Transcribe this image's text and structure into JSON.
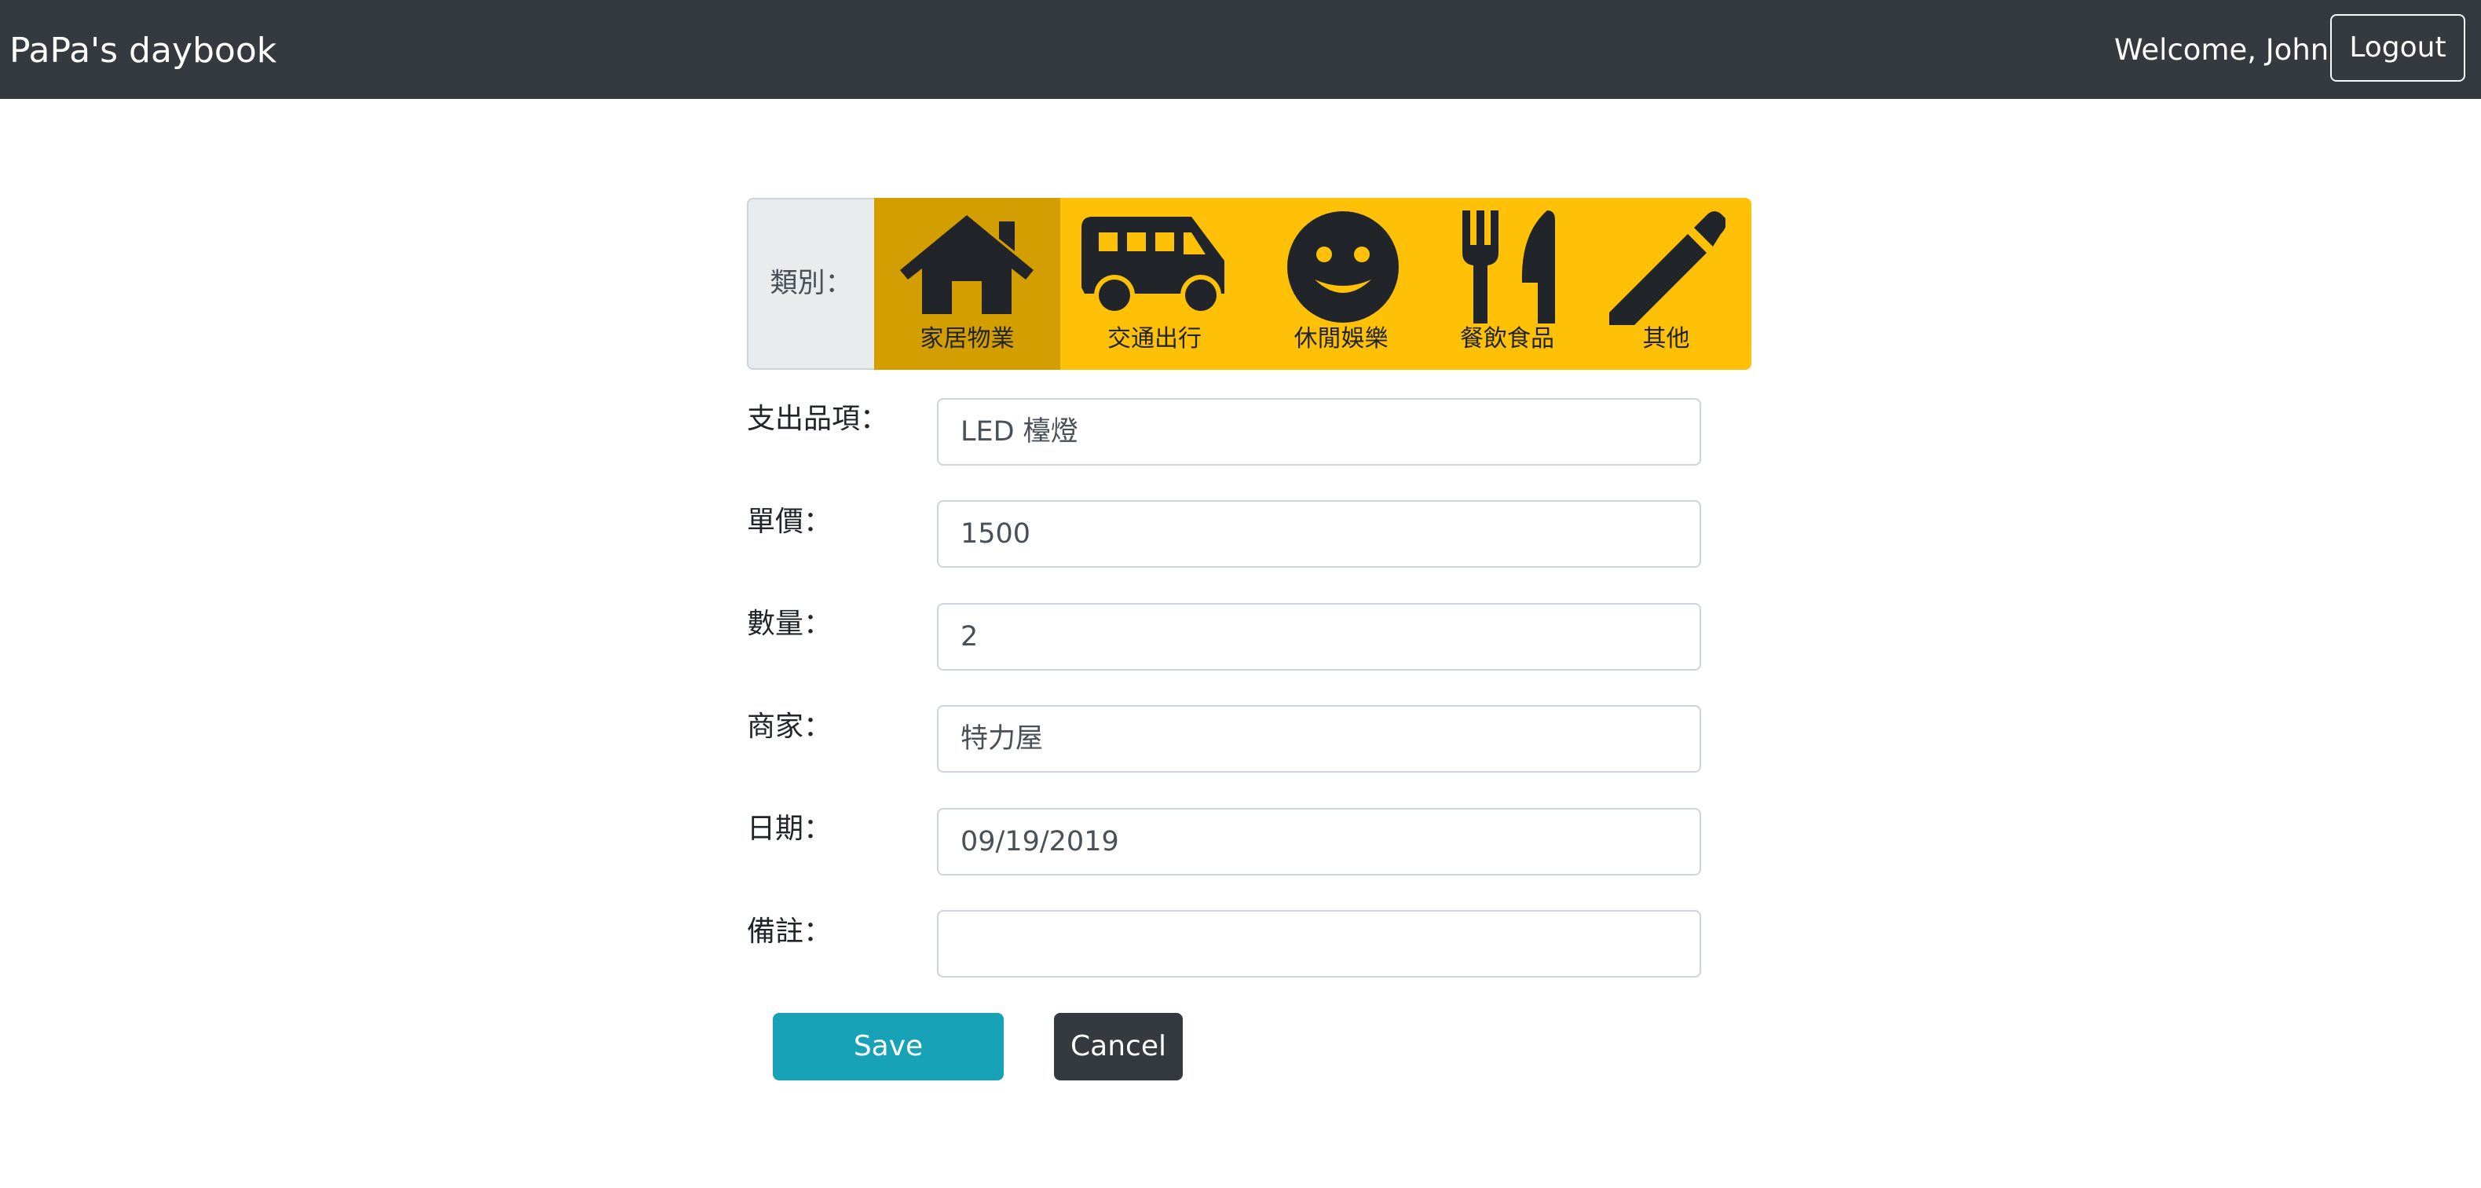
{
  "navbar": {
    "brand": "PaPa's daybook",
    "welcome": "Welcome, John",
    "logout_label": "Logout"
  },
  "category": {
    "label": "類別：",
    "items": [
      {
        "label": "家居物業",
        "icon": "house-icon",
        "selected": true
      },
      {
        "label": "交通出行",
        "icon": "bus-icon",
        "selected": false
      },
      {
        "label": "休閒娛樂",
        "icon": "smile-icon",
        "selected": false
      },
      {
        "label": "餐飲食品",
        "icon": "utensils-icon",
        "selected": false
      },
      {
        "label": "其他",
        "icon": "pencil-icon",
        "selected": false
      }
    ]
  },
  "form": {
    "item": {
      "label": "支出品項：",
      "value": "LED 檯燈"
    },
    "unit_price": {
      "label": "單價：",
      "value": "1500"
    },
    "quantity": {
      "label": "數量：",
      "value": "2"
    },
    "merchant": {
      "label": "商家：",
      "value": "特力屋"
    },
    "date": {
      "label": "日期：",
      "value": "09/19/2019"
    },
    "note": {
      "label": "備註：",
      "value": ""
    }
  },
  "actions": {
    "save_label": "Save",
    "cancel_label": "Cancel"
  },
  "colors": {
    "navbar": "#343a40",
    "category_bar": "#ffc107",
    "category_selected": "#d39e00",
    "save": "#17a2b8",
    "cancel": "#343a40"
  }
}
